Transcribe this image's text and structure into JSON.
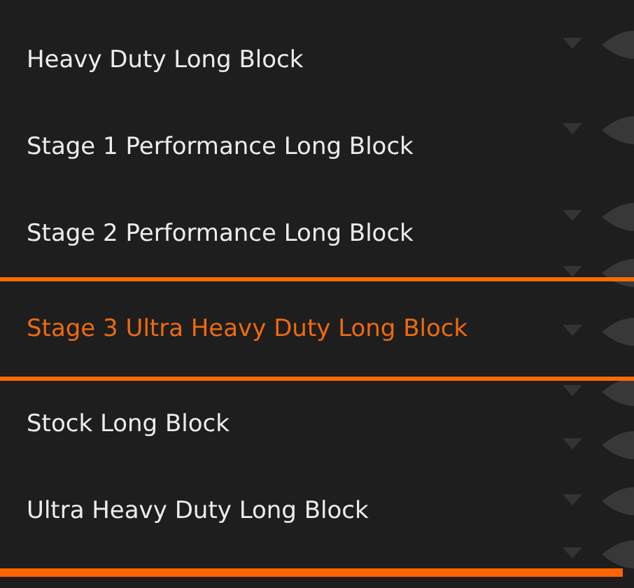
{
  "dropdown": {
    "options": [
      {
        "label": "Heavy Duty Long Block",
        "selected": false
      },
      {
        "label": "Stage 1 Performance Long Block",
        "selected": false
      },
      {
        "label": "Stage 2 Performance Long Block",
        "selected": false
      },
      {
        "label": "Stage 3 Ultra Heavy Duty Long Block",
        "selected": true
      },
      {
        "label": "Stock Long Block",
        "selected": false
      },
      {
        "label": "Ultra Heavy Duty Long Block",
        "selected": false
      }
    ]
  }
}
